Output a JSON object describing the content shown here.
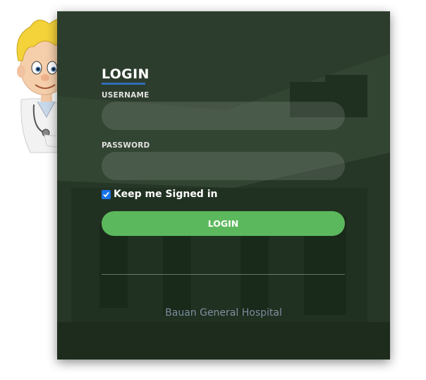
{
  "login": {
    "title": "LOGIN",
    "username_label": "USERNAME",
    "username_value": "",
    "password_label": "PASSWORD",
    "password_value": "",
    "remember_label": "Keep me Signed in",
    "remember_checked": true,
    "submit_label": "LOGIN"
  },
  "footer": {
    "text": "Bauan General Hospital"
  },
  "icons": {
    "mascot": "doctor-mascot-icon",
    "check": "check-icon"
  },
  "colors": {
    "accent_underline": "#2f6db8",
    "button": "#5cb85c",
    "checkbox": "#1a73e8"
  }
}
